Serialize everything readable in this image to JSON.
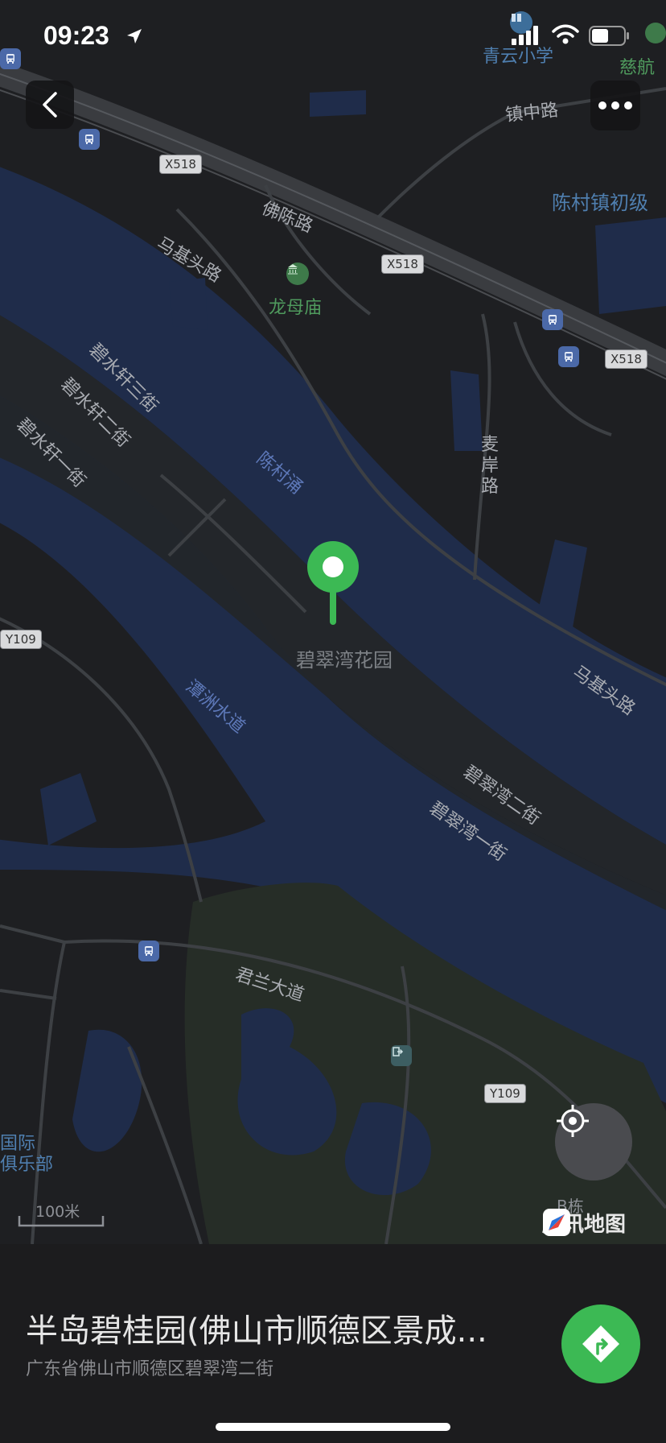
{
  "status_bar": {
    "time": "09:23",
    "icons": [
      "location-arrow-icon",
      "signal-icon",
      "wifi-icon",
      "battery-icon"
    ]
  },
  "map": {
    "roads": [
      "佛陈路",
      "马基头路",
      "镇中路",
      "麦岸路",
      "马基头路",
      "碧翠湾二街",
      "碧翠湾一街",
      "君兰大道",
      "碧水轩三街",
      "碧水轩二街",
      "碧水轩一街"
    ],
    "waters": [
      "陈村涌",
      "潭洲水道"
    ],
    "pois": {
      "temple": "龙母庙",
      "school": "青云小学",
      "school2": "陈村镇初级",
      "cihang": "慈航",
      "club1": "国际",
      "club2": "俱乐部",
      "building": "B栋",
      "marker": "碧翠湾花园"
    },
    "shields": [
      "X518",
      "X518",
      "X518",
      "Y109",
      "Y109"
    ],
    "scale": "100米",
    "brand": "腾讯地图"
  },
  "place": {
    "name": "半岛碧桂园(佛山市顺德区景成...",
    "address": "广东省佛山市顺德区碧翠湾二街"
  },
  "colors": {
    "accent": "#3cb954",
    "water": "#1f2c4a",
    "land": "#1e1f22"
  }
}
